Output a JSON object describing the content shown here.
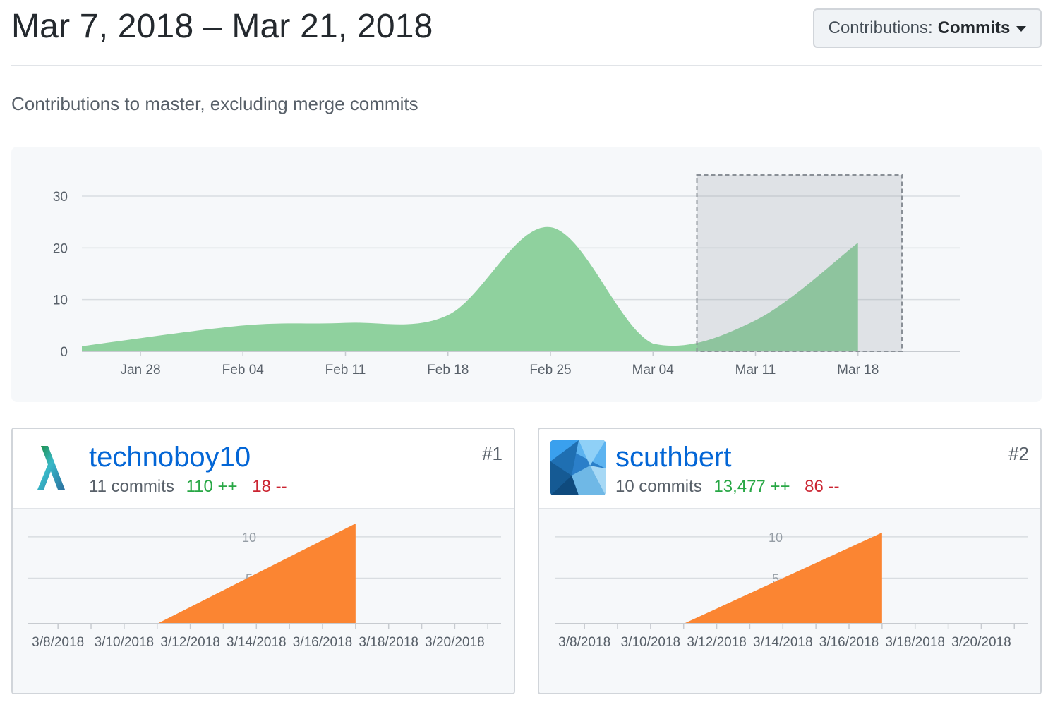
{
  "header": {
    "date_range": "Mar 7, 2018 – Mar 21, 2018",
    "contributions_label": "Contributions:",
    "contributions_value": "Commits"
  },
  "subtitle": "Contributions to master, excluding merge commits",
  "colors": {
    "main_area": "#8fd19e",
    "main_area_selected": "#7bba8b",
    "user_area": "#fb8532",
    "link": "#0366d6",
    "additions": "#28a745",
    "deletions": "#cb2431"
  },
  "chart_data": [
    {
      "type": "area",
      "y_ticks": [
        "0",
        "10",
        "20",
        "30"
      ],
      "ylim": [
        0,
        30
      ],
      "x_ticks": [
        "Jan 28",
        "Feb 04",
        "Feb 11",
        "Feb 18",
        "Feb 25",
        "Mar 04",
        "Mar 11",
        "Mar 18"
      ],
      "x": [
        "2018-01-28",
        "2018-02-04",
        "2018-02-11",
        "2018-02-18",
        "2018-02-25",
        "2018-03-04",
        "2018-03-11",
        "2018-03-18"
      ],
      "values": [
        1,
        5,
        5.5,
        7,
        24,
        1.5,
        6,
        21
      ],
      "selection": [
        "2018-03-07",
        "2018-03-21"
      ],
      "grid": true
    },
    {
      "type": "area",
      "user": "technoboy10",
      "y_ticks": [
        "5",
        "10"
      ],
      "ylim": [
        0,
        11
      ],
      "x_ticks": [
        "3/8/2018",
        "3/10/2018",
        "3/12/2018",
        "3/14/2018",
        "3/16/2018",
        "3/18/2018",
        "3/20/2018"
      ],
      "x": [
        "2018-03-10",
        "2018-03-11",
        "2018-03-17"
      ],
      "values": [
        0,
        0,
        11
      ],
      "grid": true
    },
    {
      "type": "area",
      "user": "scuthbert",
      "y_ticks": [
        "5",
        "10"
      ],
      "ylim": [
        0,
        11
      ],
      "x_ticks": [
        "3/8/2018",
        "3/10/2018",
        "3/12/2018",
        "3/14/2018",
        "3/16/2018",
        "3/18/2018",
        "3/20/2018"
      ],
      "x": [
        "2018-03-10",
        "2018-03-11",
        "2018-03-17"
      ],
      "values": [
        0,
        0,
        10
      ],
      "grid": true
    }
  ],
  "contributors": [
    {
      "username": "technoboy10",
      "rank": "#1",
      "commits": "11 commits",
      "additions": "110 ++",
      "deletions": "18 --",
      "avatar_icon": "lambda-avatar-icon"
    },
    {
      "username": "scuthbert",
      "rank": "#2",
      "commits": "10 commits",
      "additions": "13,477 ++",
      "deletions": "86 --",
      "avatar_icon": "geometric-avatar-icon"
    }
  ]
}
